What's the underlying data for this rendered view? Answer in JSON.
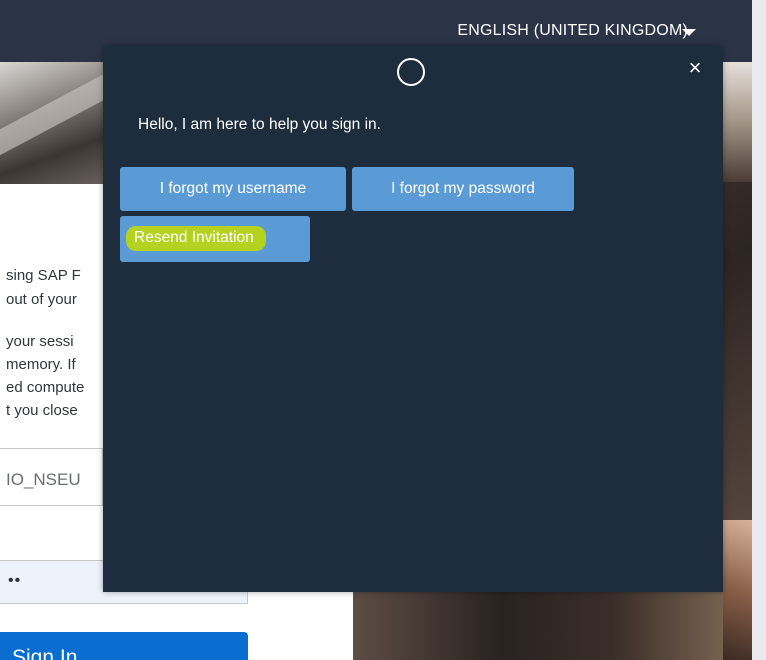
{
  "header": {
    "language": "ENGLISH (UNITED KINGDOM)",
    "language_caret_icon": "caret-down-icon"
  },
  "login_card": {
    "text_fragments": [
      "sing SAP F",
      "out of your",
      "your sessi",
      "memory. If",
      "ed compute",
      "t you close"
    ],
    "username_value": "IO_NSEU",
    "password_mask": "••",
    "signin_label": "Sign In"
  },
  "assistant": {
    "logo_icon": "ring-icon",
    "close_icon": "close-icon",
    "close_glyph": "×",
    "greeting": "Hello, I am here to help you sign in.",
    "buttons": [
      {
        "label": "I forgot my username"
      },
      {
        "label": "I forgot my password"
      },
      {
        "label": "Resend Invitation"
      }
    ],
    "highlight_color": "#b4d21f",
    "button_color": "#5b9bd5",
    "panel_color": "#1d2d3e"
  }
}
